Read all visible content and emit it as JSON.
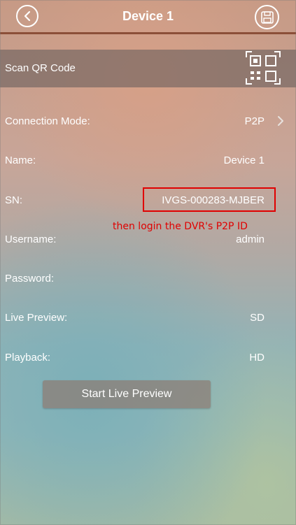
{
  "header": {
    "title": "Device 1",
    "back_icon": "chevron-left-icon",
    "save_icon": "save-disk-icon"
  },
  "scan": {
    "label": "Scan QR Code",
    "icon": "qr-code-icon"
  },
  "fields": {
    "connection_mode": {
      "label": "Connection Mode:",
      "value": "P2P",
      "icon": "chevron-right-icon"
    },
    "name": {
      "label": "Name:",
      "value": "Device 1"
    },
    "sn": {
      "label": "SN:",
      "value": "IVGS-000283-MJBER"
    },
    "username": {
      "label": "Username:",
      "value": "admin"
    },
    "password": {
      "label": "Password:",
      "value": ""
    },
    "live_preview": {
      "label": "Live Preview:",
      "value": "SD"
    },
    "playback": {
      "label": "Playback:",
      "value": "HD"
    }
  },
  "annotation": {
    "text": "then login the DVR's P2P ID",
    "color": "#e00000"
  },
  "actions": {
    "start_live_preview": "Start Live Preview"
  },
  "colors": {
    "header_rule": "#8b4f38",
    "highlight_box": "#e00000"
  }
}
